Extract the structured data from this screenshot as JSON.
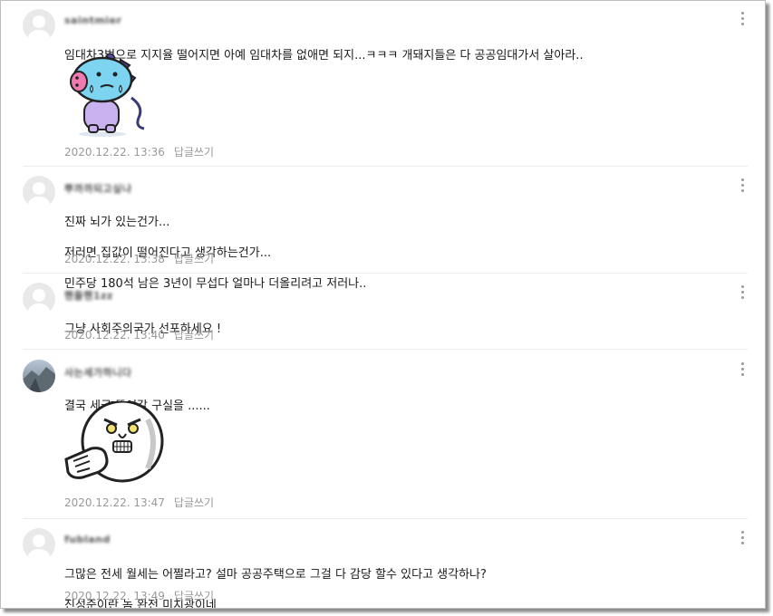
{
  "reply_label": "답글쓰기",
  "comments": [
    {
      "nickname": "saintmier",
      "lines": [
        "임대차3법으로 지지율 떨어지면 아예 임대차를 없애면 되지...ㅋㅋㅋ 개돼지들은 다 공공임대가서 살아라.."
      ],
      "date": "2020.12.22. 13:36",
      "sticker": "mang-sweating-sticker"
    },
    {
      "nickname": "뿌까까되고싶냐",
      "lines": [
        "진짜 뇌가 있는건가...",
        "저러면 집값이 떨어진다고 생각하는건가...",
        "민주당 180석 남은 3년이 무섭다 얼마나 더올리려고 저러나.."
      ],
      "date": "2020.12.22. 13:38"
    },
    {
      "nickname": "핸들핸1zz",
      "lines": [
        "그냥 사회주의국가 선포하세요 !"
      ],
      "date": "2020.12.22. 13:40"
    },
    {
      "nickname": "사는세가하니다",
      "lines": [
        "결국 세금 뜯어갈 구실을 ......"
      ],
      "date": "2020.12.22. 13:47",
      "sticker": "moon-pointing-sticker"
    },
    {
      "nickname": "fubland",
      "lines": [
        "그많은 전세 월세는 어쩔라고? 설마 공공주택으로 그걸 다 감당 할수 있다고 생각하나?",
        "진성준이란 놈 완전 미치광이네"
      ],
      "date": "2020.12.22. 13:49"
    }
  ]
}
